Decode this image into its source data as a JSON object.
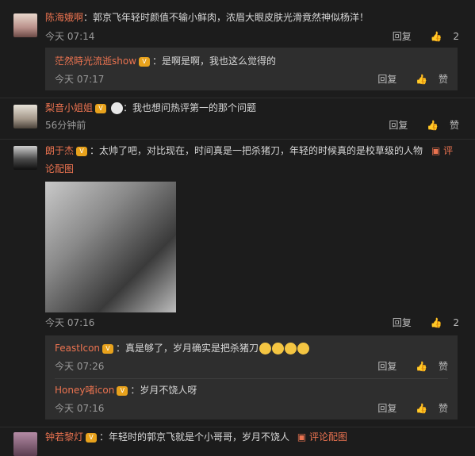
{
  "comments": [
    {
      "name": "陈海娥啊",
      "text": "：郭京飞年轻时颜值不输小鲜肉，浓眉大眼皮肤光滑竟然神似杨洋！",
      "time": "今天 07:14",
      "reply_label": "回复",
      "like_label": "2",
      "replies": [
        {
          "name": "茫然時光流逝show",
          "text": "：是啊是啊，我也这么觉得的",
          "time": "今天 07:17",
          "reply_label": "回复",
          "like_label": "赞"
        }
      ]
    },
    {
      "name": "梨音小姐姐",
      "text": "：我也想问热评第一的那个问题",
      "time": "56分钟前",
      "reply_label": "回复",
      "like_label": "赞"
    },
    {
      "name": "朗于杰",
      "text_line1": "：太帅了吧，对比现在，时间真是一把杀猪刀，年轻的时候真的是校草级的人物",
      "link_label_a": "评",
      "text_line2": "论配图",
      "time": "今天 07:16",
      "reply_label": "回复",
      "like_label": "2",
      "replies": [
        {
          "name": "FeastIcon",
          "text": "：真是够了，岁月确实是把杀猪刀",
          "time": "今天 07:26",
          "reply_label": "回复",
          "like_label": "赞"
        },
        {
          "name": "Honey啫icon",
          "text": "：岁月不饶人呀",
          "time": "今天 07:16",
          "reply_label": "回复",
          "like_label": "赞"
        }
      ]
    },
    {
      "name": "钟若黎灯",
      "text": "：年轻时的郭京飞就是个小哥哥，岁月不饶人",
      "link_label": "评论配图"
    }
  ]
}
